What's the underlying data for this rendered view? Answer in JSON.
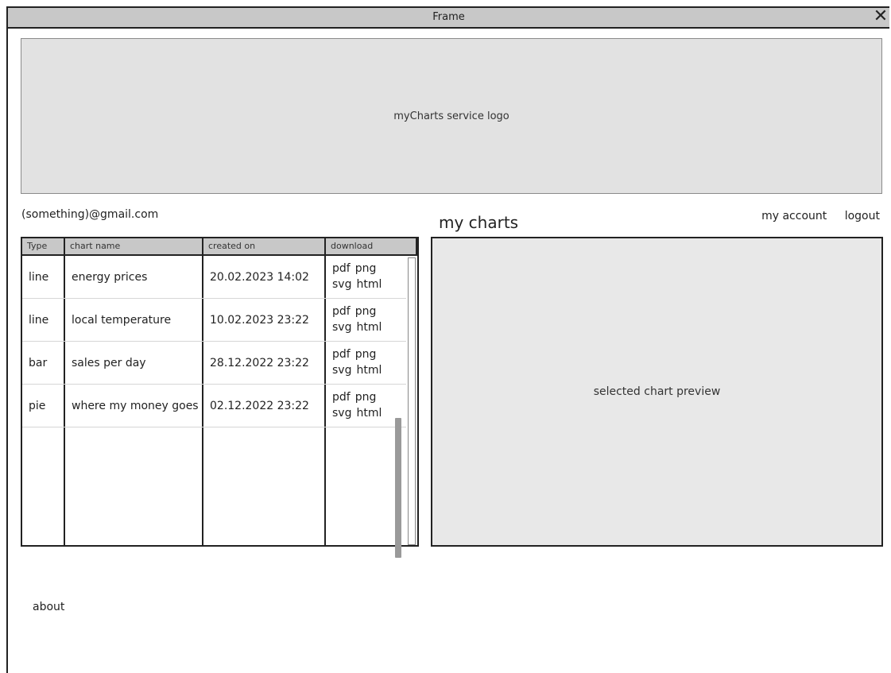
{
  "window": {
    "title": "Frame",
    "close_symbol": "✕"
  },
  "logo": {
    "text": "myCharts service logo"
  },
  "user": {
    "email": "(something)@gmail.com"
  },
  "main": {
    "title": "my charts",
    "links": {
      "account": "my account",
      "logout": "logout"
    }
  },
  "table": {
    "headers": {
      "type": "Type",
      "name": "chart name",
      "created": "created on",
      "download": "download"
    },
    "rows": [
      {
        "type": "line",
        "name": "energy prices",
        "created": "20.02.2023 14:02",
        "downloads": [
          "pdf",
          "png",
          "svg",
          "html"
        ]
      },
      {
        "type": "line",
        "name": "local temperature",
        "created": "10.02.2023 23:22",
        "downloads": [
          "pdf",
          "png",
          "svg",
          "html"
        ]
      },
      {
        "type": "bar",
        "name": "sales per day",
        "created": "28.12.2022 23:22",
        "downloads": [
          "pdf",
          "png",
          "svg",
          "html"
        ]
      },
      {
        "type": "pie",
        "name": "where my money goes",
        "created": "02.12.2022 23:22",
        "downloads": [
          "pdf",
          "png",
          "svg",
          "html"
        ]
      }
    ]
  },
  "preview": {
    "text": "selected chart preview"
  },
  "footer": {
    "about": "about"
  },
  "icons": {
    "close": "close-icon"
  }
}
